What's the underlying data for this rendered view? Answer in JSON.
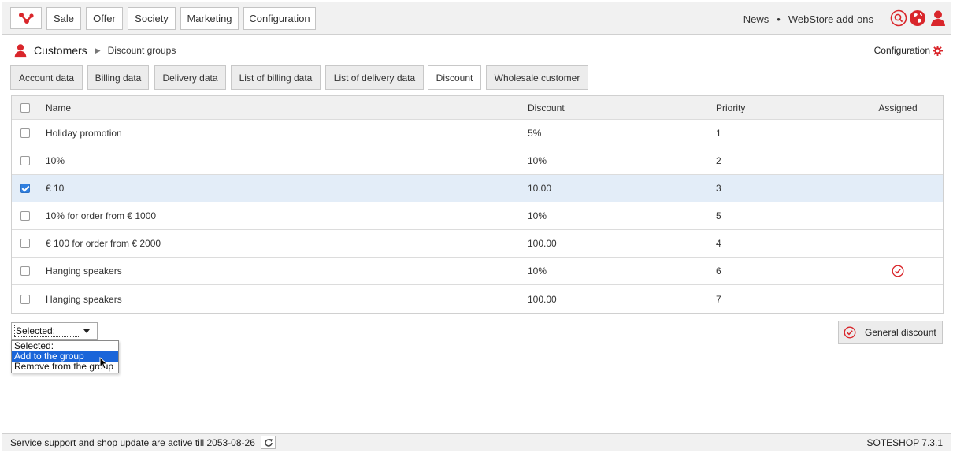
{
  "nav": {
    "menu": [
      "Sale",
      "Offer",
      "Society",
      "Marketing",
      "Configuration"
    ],
    "links": [
      "News",
      "WebStore add-ons"
    ],
    "link_separator": "•"
  },
  "header": {
    "title": "Customers",
    "breadcrumb": "Discount groups",
    "config_label": "Configuration"
  },
  "tabs": [
    {
      "label": "Account data",
      "active": false
    },
    {
      "label": "Billing data",
      "active": false
    },
    {
      "label": "Delivery data",
      "active": false
    },
    {
      "label": "List of billing data",
      "active": false
    },
    {
      "label": "List of delivery data",
      "active": false
    },
    {
      "label": "Discount",
      "active": true
    },
    {
      "label": "Wholesale customer",
      "active": false
    }
  ],
  "table": {
    "columns": [
      "Name",
      "Discount",
      "Priority",
      "Assigned"
    ],
    "rows": [
      {
        "name": "Holiday promotion",
        "discount": "5%",
        "priority": "1",
        "assigned": false,
        "checked": false
      },
      {
        "name": "10%",
        "discount": "10%",
        "priority": "2",
        "assigned": false,
        "checked": false
      },
      {
        "name": "€ 10",
        "discount": "10.00",
        "priority": "3",
        "assigned": false,
        "checked": true
      },
      {
        "name": "10% for order from € 1000",
        "discount": "10%",
        "priority": "5",
        "assigned": false,
        "checked": false
      },
      {
        "name": "€ 100 for order from € 2000",
        "discount": "100.00",
        "priority": "4",
        "assigned": false,
        "checked": false
      },
      {
        "name": "Hanging speakers",
        "discount": "10%",
        "priority": "6",
        "assigned": true,
        "checked": false
      },
      {
        "name": "Hanging speakers",
        "discount": "100.00",
        "priority": "7",
        "assigned": false,
        "checked": false
      }
    ]
  },
  "action_select": {
    "value": "Selected:",
    "options": [
      "Selected:",
      "Add to the group",
      "Remove from the group"
    ],
    "highlighted_index": 1
  },
  "general_discount_label": "General discount",
  "footer": {
    "support_text": "Service support and shop update are active till 2053-08-26",
    "version": "SOTESHOP 7.3.1"
  },
  "colors": {
    "accent": "#d9262b",
    "selected_row": "#e3edf8",
    "highlight": "#1a65d9"
  },
  "icons": {
    "logo": "share-nodes-icon",
    "search": "search-icon",
    "globe": "globe-icon",
    "user": "user-icon",
    "gear": "gear-icon",
    "assigned": "check-circle-icon",
    "refresh": "refresh-icon"
  }
}
